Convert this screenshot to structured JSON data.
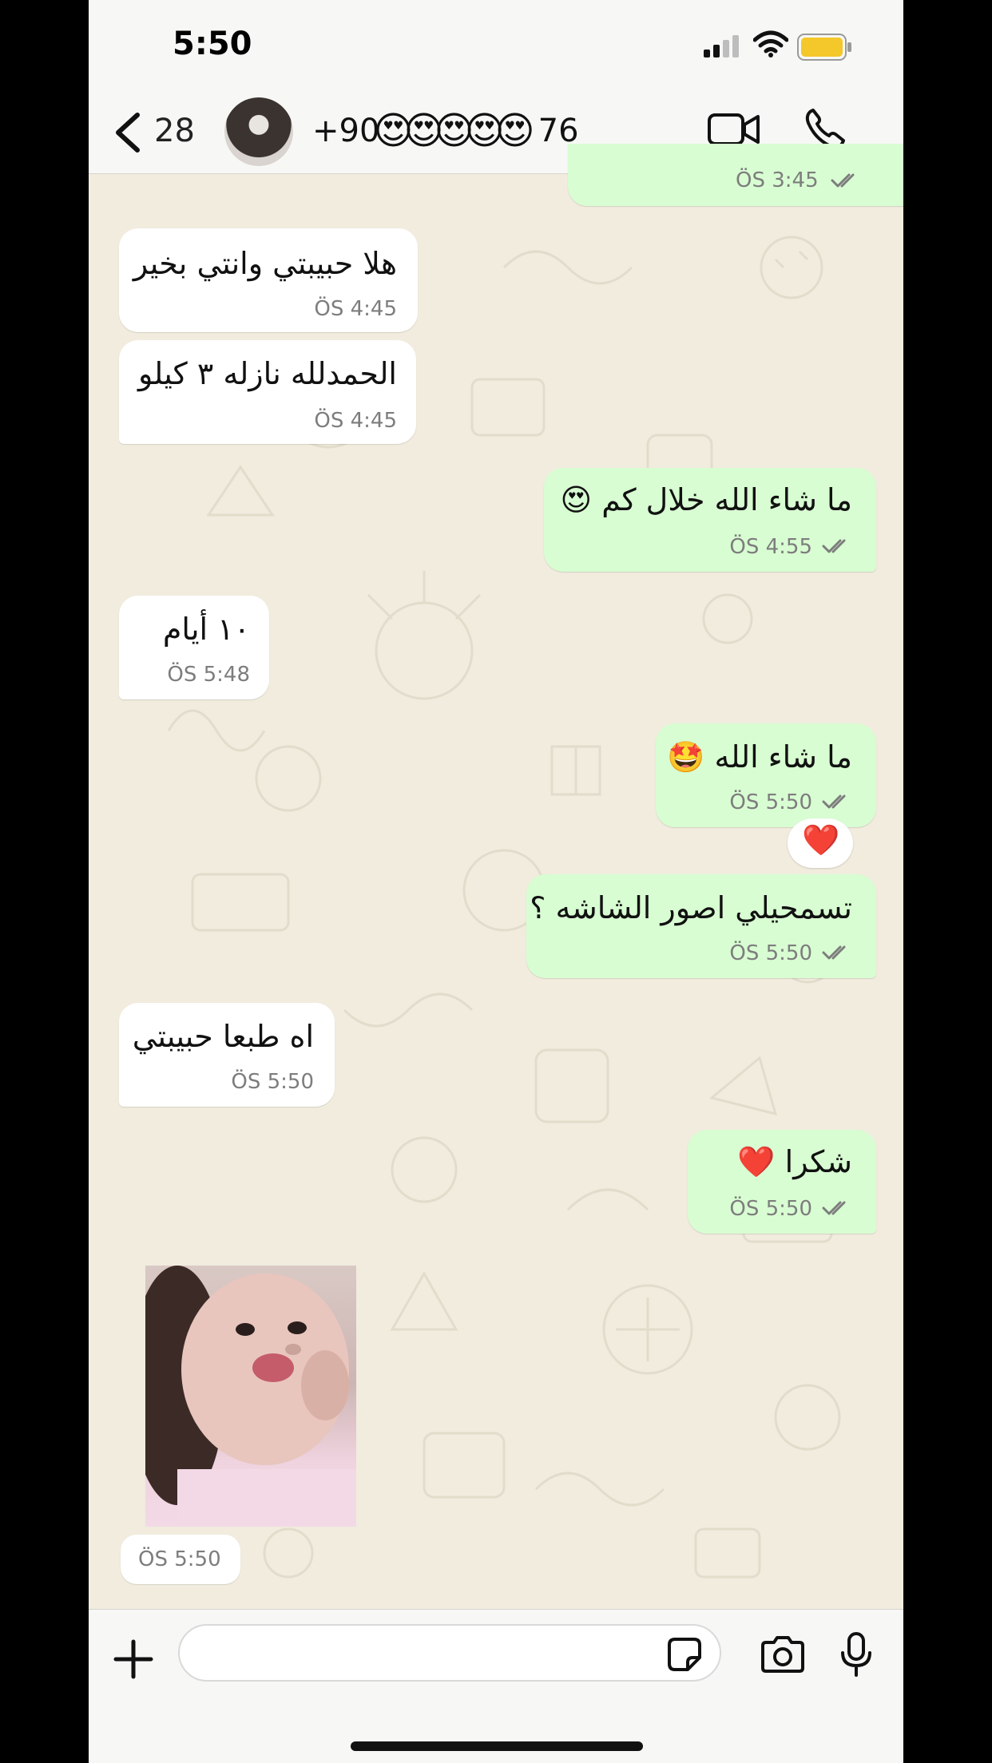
{
  "status_bar": {
    "time": "5:50"
  },
  "header": {
    "back_count": "28",
    "contact_prefix": "+90",
    "contact_emojis": [
      "😍",
      "😍",
      "😍",
      "😍",
      "😍"
    ],
    "contact_suffix": "76"
  },
  "messages": [
    {
      "dir": "out",
      "text": "",
      "time": "ÖS 3:45",
      "read": true
    },
    {
      "dir": "in",
      "text": "هلا حبيبتي وانتي بخير",
      "time": "ÖS 4:45"
    },
    {
      "dir": "in",
      "text": "الحمدلله نازله ٣ كيلو",
      "time": "ÖS 4:45"
    },
    {
      "dir": "out",
      "text": "ما شاء الله خلال كم 😍",
      "time": "ÖS 4:55",
      "read": true
    },
    {
      "dir": "in",
      "text": "١٠ أيام",
      "time": "ÖS 5:48"
    },
    {
      "dir": "out",
      "text": "ما شاء الله 🤩",
      "time": "ÖS 5:50",
      "read": true,
      "reaction": "❤️"
    },
    {
      "dir": "out",
      "text": "تسمحيلي اصور الشاشه ؟",
      "time": "ÖS 5:50",
      "read": true
    },
    {
      "dir": "in",
      "text": "اه طبعا حبيبتي",
      "time": "ÖS 5:50"
    },
    {
      "dir": "out",
      "text": "شكرا ❤️",
      "time": "ÖS 5:50",
      "read": true
    },
    {
      "dir": "in",
      "type": "photo",
      "time": "ÖS 5:50"
    }
  ],
  "reaction": "❤️",
  "input": {
    "placeholder": ""
  },
  "colors": {
    "incoming": "#ffffff",
    "outgoing": "#d8fdd2",
    "wallpaper": "#f1ecde",
    "tick": "#7d7d7d"
  }
}
